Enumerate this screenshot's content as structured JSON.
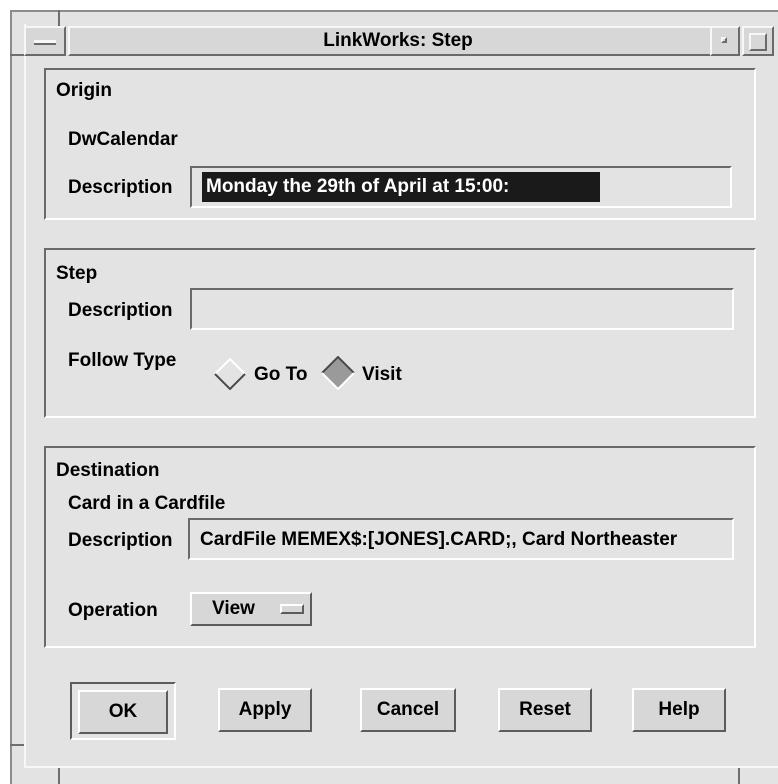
{
  "window": {
    "title": "LinkWorks: Step"
  },
  "origin": {
    "heading": "Origin",
    "object": "DwCalendar",
    "description_label": "Description",
    "description_value": "Monday the 29th of April at 15:00:"
  },
  "step": {
    "heading": "Step",
    "description_label": "Description",
    "description_value": "",
    "follow_type_label": "Follow Type",
    "options": [
      {
        "label": "Go To",
        "selected": false
      },
      {
        "label": "Visit",
        "selected": true
      }
    ]
  },
  "destination": {
    "heading": "Destination",
    "object": "Card in a Cardfile",
    "description_label": "Description",
    "description_value": "CardFile MEMEX$:[JONES].CARD;, Card Northeaster",
    "operation_label": "Operation",
    "operation_value": "View"
  },
  "buttons": {
    "ok": "OK",
    "apply": "Apply",
    "cancel": "Cancel",
    "reset": "Reset",
    "help": "Help"
  }
}
